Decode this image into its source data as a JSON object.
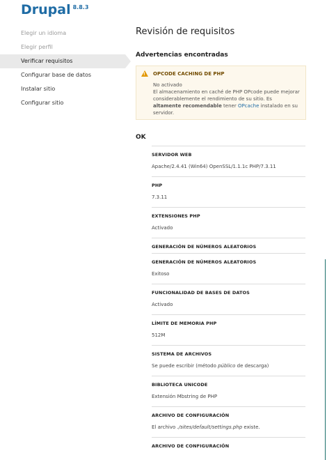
{
  "brand": {
    "name": "Drupal",
    "version": "8.8.3"
  },
  "steps": [
    {
      "label": "Elegir un idioma",
      "state": "done"
    },
    {
      "label": "Elegir perfil",
      "state": "done"
    },
    {
      "label": "Verificar requisitos",
      "state": "active"
    },
    {
      "label": "Configurar base de datos",
      "state": "pending"
    },
    {
      "label": "Instalar sitio",
      "state": "pending"
    },
    {
      "label": "Configurar sitio",
      "state": "pending"
    }
  ],
  "main": {
    "title": "Revisión de requisitos",
    "warnings_heading": "Advertencias encontradas",
    "warning": {
      "title": "OPCODE CACHING DE PHP",
      "status": "No activado",
      "text_before": "El almacenamiento en caché de PHP OPcode puede mejorar considerablemente el rendimiento de su sitio. Es ",
      "bold": "altamente recomendable",
      "text_mid": " tener ",
      "link": "OPcache",
      "text_after": " instalado en su servidor."
    },
    "ok_heading": "OK",
    "requirements": [
      {
        "name": "SERVIDOR WEB",
        "value": "Apache/2.4.41 (Win64) OpenSSL/1.1.1c PHP/7.3.11"
      },
      {
        "name": "PHP",
        "value": "7.3.11"
      },
      {
        "name": "EXTENSIONES PHP",
        "value": "Activado"
      },
      {
        "name": "GENERACIÓN DE NÚMEROS ALEATORIOS",
        "value": ""
      },
      {
        "name": "GENERACIÓN DE NÚMEROS ALEATORIOS",
        "value": "Exitoso"
      },
      {
        "name": "FUNCIONALIDAD DE BASES DE DATOS",
        "value": "Activado"
      },
      {
        "name": "LÍMITE DE MEMORIA PHP",
        "value": "512M"
      },
      {
        "name": "SISTEMA DE ARCHIVOS",
        "value_pre": "Se puede escribir (método ",
        "value_em": "público",
        "value_post": " de descarga)"
      },
      {
        "name": "BIBLIOTECA UNICODE",
        "value": "Extensión Mbstring de PHP"
      },
      {
        "name": "ARCHIVO DE CONFIGURACIÓN",
        "value_pre": "El archivo ",
        "value_em": "./sites/default/settings.php",
        "value_post": " existe."
      },
      {
        "name": "ARCHIVO DE CONFIGURACIÓN",
        "value": ""
      }
    ]
  },
  "colors": {
    "brand": "#1f6ca5",
    "warning_bg": "#fdf8ed",
    "warning_icon": "#e29700"
  }
}
